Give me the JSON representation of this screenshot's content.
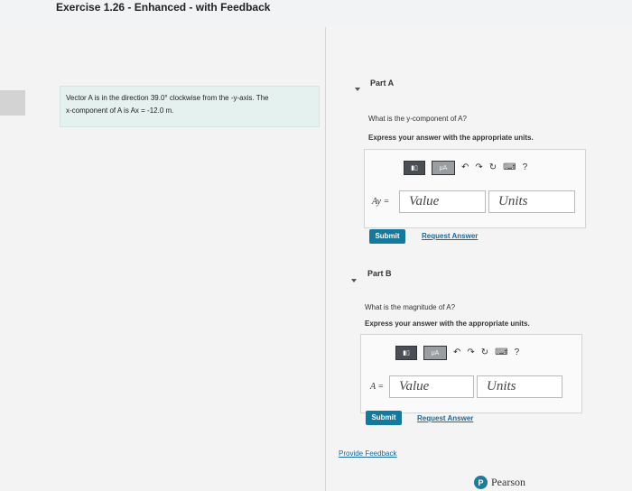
{
  "header": {
    "title": "Exercise 1.26 - Enhanced - with Feedback"
  },
  "problem": {
    "line1": "Vector A is in the direction 39.0° clockwise from the -y-axis. The",
    "line2": "x-component of A is Ax = -12.0 m."
  },
  "partA": {
    "heading": "Part A",
    "question": "What is the y-component of A?",
    "instruction": "Express your answer with the appropriate units.",
    "var_label": "Ay =",
    "value_placeholder": "Value",
    "units_placeholder": "Units",
    "submit": "Submit",
    "request": "Request Answer"
  },
  "partB": {
    "heading": "Part B",
    "question": "What is the magnitude of A?",
    "instruction": "Express your answer with the appropriate units.",
    "var_label": "A =",
    "value_placeholder": "Value",
    "units_placeholder": "Units",
    "submit": "Submit",
    "request": "Request Answer"
  },
  "toolbar": {
    "mu": "μA",
    "help": "?"
  },
  "footer": {
    "feedback": "Provide Feedback",
    "brand": "Pearson",
    "brand_letter": "P"
  }
}
